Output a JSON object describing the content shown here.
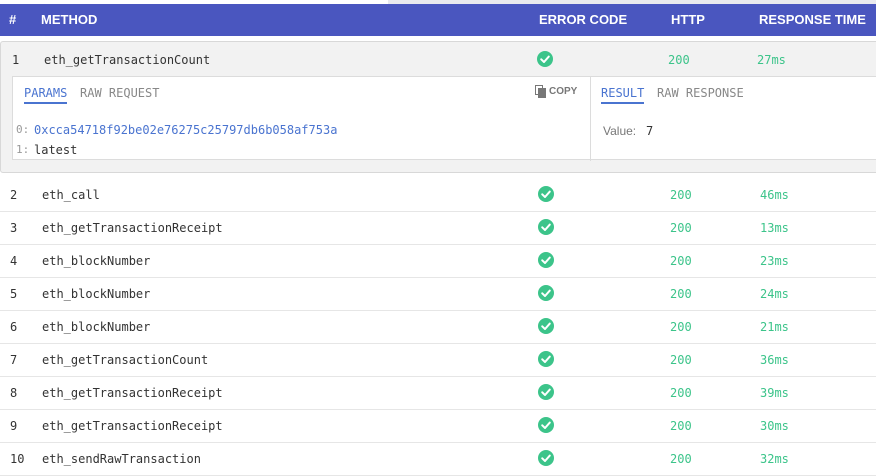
{
  "header": {
    "num": "#",
    "method": "METHOD",
    "error_code": "ERROR CODE",
    "http": "HTTP",
    "response_time": "RESPONSE TIME"
  },
  "expanded_row": {
    "num": "1",
    "method": "eth_getTransactionCount",
    "status_icon": "check-circle-icon",
    "http": "200",
    "time": "27ms",
    "tabs": {
      "params": "PARAMS",
      "raw_request": "RAW REQUEST",
      "result": "RESULT",
      "raw_response": "RAW RESPONSE",
      "copy": "COPY"
    },
    "params": [
      {
        "index": "0:",
        "value": "0xcca54718f92be02e76275c25797db6b058af753a"
      },
      {
        "index": "1:",
        "value": "latest"
      }
    ],
    "result": {
      "label": "Value:",
      "value": "7"
    }
  },
  "rows": [
    {
      "num": "2",
      "method": "eth_call",
      "http": "200",
      "time": "46ms"
    },
    {
      "num": "3",
      "method": "eth_getTransactionReceipt",
      "http": "200",
      "time": "13ms"
    },
    {
      "num": "4",
      "method": "eth_blockNumber",
      "http": "200",
      "time": "23ms"
    },
    {
      "num": "5",
      "method": "eth_blockNumber",
      "http": "200",
      "time": "24ms"
    },
    {
      "num": "6",
      "method": "eth_blockNumber",
      "http": "200",
      "time": "21ms"
    },
    {
      "num": "7",
      "method": "eth_getTransactionCount",
      "http": "200",
      "time": "36ms"
    },
    {
      "num": "8",
      "method": "eth_getTransactionReceipt",
      "http": "200",
      "time": "39ms"
    },
    {
      "num": "9",
      "method": "eth_getTransactionReceipt",
      "http": "200",
      "time": "30ms"
    },
    {
      "num": "10",
      "method": "eth_sendRawTransaction",
      "http": "200",
      "time": "32ms"
    }
  ],
  "colors": {
    "header_bg": "#4a56bf",
    "success": "#3cc48a",
    "link": "#4a74d0"
  }
}
